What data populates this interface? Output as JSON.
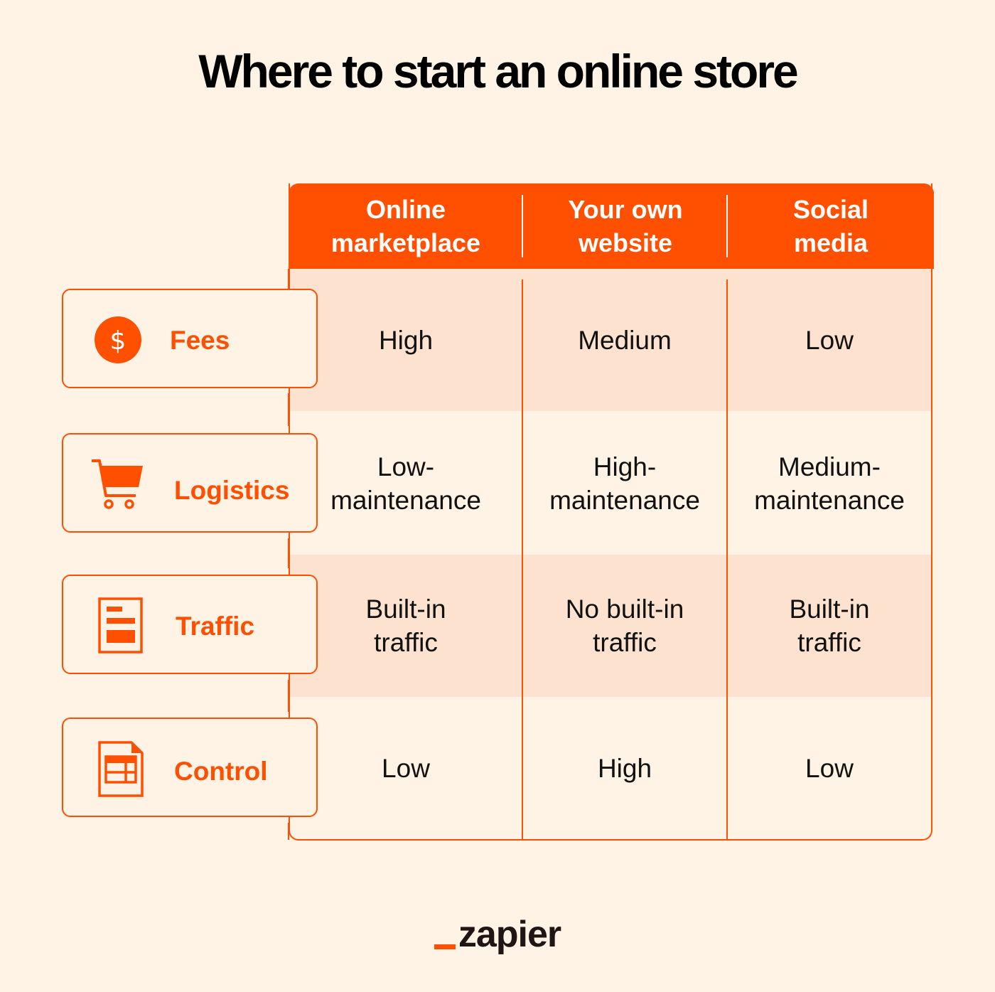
{
  "title": "Where to start an online store",
  "columns": [
    "Online marketplace",
    "Your own website",
    "Social media"
  ],
  "columns_lines": [
    [
      "Online",
      "marketplace"
    ],
    [
      "Your own",
      "website"
    ],
    [
      "Social",
      "media"
    ]
  ],
  "rows": [
    {
      "label": "Fees",
      "icon": "dollar-icon",
      "values": [
        "High",
        "Medium",
        "Low"
      ]
    },
    {
      "label": "Logistics",
      "icon": "shopping-cart-icon",
      "values": [
        "Low-\nmaintenance",
        "High-\nmaintenance",
        "Medium-\nmaintenance"
      ]
    },
    {
      "label": "Traffic",
      "icon": "document-icon",
      "values": [
        "Built-in\ntraffic",
        "No built-in\ntraffic",
        "Built-in\ntraffic"
      ]
    },
    {
      "label": "Control",
      "icon": "spreadsheet-icon",
      "values": [
        "Low",
        "High",
        "Low"
      ]
    }
  ],
  "logo": "zapier",
  "colors": {
    "accent": "#ff4f00",
    "background": "#fff3e6",
    "band": "#fde3cf",
    "text": "#111111"
  }
}
